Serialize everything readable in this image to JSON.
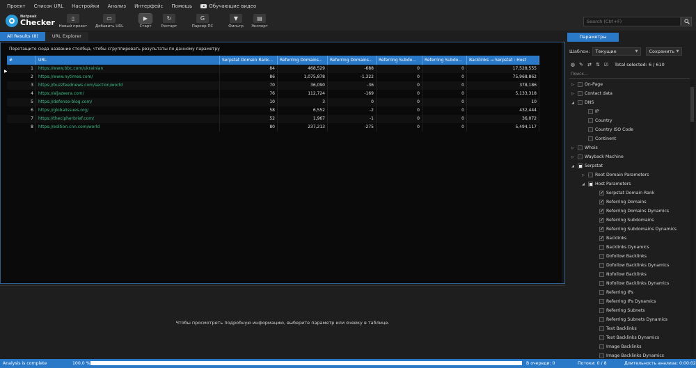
{
  "menu": [
    "Проект",
    "Список URL",
    "Настройки",
    "Анализ",
    "Интерфейс",
    "Помощь",
    "Обучающие видео"
  ],
  "logo": {
    "small": "Netpeak",
    "big": "Checker"
  },
  "toolbar": [
    {
      "label": "Новый проект",
      "icon": "new-file-icon",
      "glyph": "▯"
    },
    {
      "label": "Добавить URL",
      "icon": "folder-icon",
      "glyph": "▭"
    },
    {
      "label": "Старт",
      "icon": "play-icon",
      "glyph": "▶"
    },
    {
      "label": "Рестарт",
      "icon": "restart-icon",
      "glyph": "↻"
    },
    {
      "label": "Парсер ПС",
      "icon": "google-icon",
      "glyph": "G"
    },
    {
      "label": "Фильтр",
      "icon": "filter-icon",
      "glyph": "▼"
    },
    {
      "label": "Экспорт",
      "icon": "export-icon",
      "glyph": "▤"
    }
  ],
  "search": {
    "placeholder": "Search (Ctrl+F)"
  },
  "tabs": [
    "All Results (8)",
    "URL Explorer"
  ],
  "grid": {
    "group_hint": "Перетащите сюда название столбца, чтобы сгруппировать результаты по данному параметру",
    "columns": [
      "#",
      "URL",
      "Serpstat Domain Rank...",
      "Referring Domains...",
      "Referring Domains...",
      "Referring Subdo...",
      "Referring Subdo...",
      "Backlinks → Serpstat : Host"
    ],
    "rows": [
      [
        "1",
        "https://www.bbc.com/ukrainian",
        "84",
        "468,529",
        "-688",
        "0",
        "0",
        "17,528,555"
      ],
      [
        "2",
        "https://www.nytimes.com/",
        "86",
        "1,075,878",
        "-1,322",
        "0",
        "0",
        "75,968,862"
      ],
      [
        "3",
        "https://buzzfeednews.com/section/world",
        "70",
        "36,090",
        "-36",
        "0",
        "0",
        "378,186"
      ],
      [
        "4",
        "https://aljazeera.com/",
        "76",
        "112,724",
        "-169",
        "0",
        "0",
        "5,133,318"
      ],
      [
        "5",
        "https://defense-blog.com/",
        "10",
        "3",
        "0",
        "0",
        "0",
        "10"
      ],
      [
        "6",
        "https://globalissues.org/",
        "58",
        "6,552",
        "-2",
        "0",
        "0",
        "432,444"
      ],
      [
        "7",
        "https://thecipherbrief.com/",
        "52",
        "1,967",
        "-1",
        "0",
        "0",
        "36,072"
      ],
      [
        "8",
        "https://edition.cnn.com/world",
        "80",
        "237,213",
        "-275",
        "0",
        "0",
        "5,494,117"
      ]
    ]
  },
  "details": {
    "hint": "Чтобы просмотреть подробную информацию, выберите параметр или ячейку в таблице."
  },
  "panel": {
    "tab": "Параметры",
    "template_label": "Шаблон:",
    "template_value": "Текущие",
    "save_label": "Сохранить",
    "total_selected": "Total selected: 6 / 610",
    "filter_placeholder": "Поиск...",
    "tree": [
      {
        "label": "On-Page",
        "level": 0,
        "arrow": "▷",
        "check": "none"
      },
      {
        "label": "Contact data",
        "level": 0,
        "arrow": "▷",
        "check": "none"
      },
      {
        "label": "DNS",
        "level": 0,
        "arrow": "◢",
        "check": "none"
      },
      {
        "label": "IP",
        "level": 1,
        "arrow": "",
        "check": "none"
      },
      {
        "label": "Country",
        "level": 1,
        "arrow": "",
        "check": "none"
      },
      {
        "label": "Country ISO Code",
        "level": 1,
        "arrow": "",
        "check": "none"
      },
      {
        "label": "Continent",
        "level": 1,
        "arrow": "",
        "check": "none"
      },
      {
        "label": "Whois",
        "level": 0,
        "arrow": "▷",
        "check": "none"
      },
      {
        "label": "Wayback Machine",
        "level": 0,
        "arrow": "▷",
        "check": "none"
      },
      {
        "label": "Serpstat",
        "level": 0,
        "arrow": "◢",
        "check": "partial"
      },
      {
        "label": "Root Domain Parameters",
        "level": 1,
        "arrow": "▷",
        "check": "none"
      },
      {
        "label": "Host Parameters",
        "level": 1,
        "arrow": "◢",
        "check": "partial"
      },
      {
        "label": "Serpstat Domain Rank",
        "level": 2,
        "arrow": "",
        "check": "checked"
      },
      {
        "label": "Referring Domains",
        "level": 2,
        "arrow": "",
        "check": "checked"
      },
      {
        "label": "Referring Domains Dynamics",
        "level": 2,
        "arrow": "",
        "check": "checked"
      },
      {
        "label": "Referring Subdomains",
        "level": 2,
        "arrow": "",
        "check": "checked"
      },
      {
        "label": "Referring Subdomains Dynamics",
        "level": 2,
        "arrow": "",
        "check": "checked"
      },
      {
        "label": "Backlinks",
        "level": 2,
        "arrow": "",
        "check": "checked"
      },
      {
        "label": "Backlinks Dynamics",
        "level": 2,
        "arrow": "",
        "check": "none"
      },
      {
        "label": "Dofollow Backlinks",
        "level": 2,
        "arrow": "",
        "check": "none"
      },
      {
        "label": "Dofollow Backlinks Dynamics",
        "level": 2,
        "arrow": "",
        "check": "none"
      },
      {
        "label": "Nofollow Backlinks",
        "level": 2,
        "arrow": "",
        "check": "none"
      },
      {
        "label": "Nofollow Backlinks Dynamics",
        "level": 2,
        "arrow": "",
        "check": "none"
      },
      {
        "label": "Referring IPs",
        "level": 2,
        "arrow": "",
        "check": "none"
      },
      {
        "label": "Referring IPs Dynamics",
        "level": 2,
        "arrow": "",
        "check": "none"
      },
      {
        "label": "Referring Subnets",
        "level": 2,
        "arrow": "",
        "check": "none"
      },
      {
        "label": "Referring Subnets Dynamics",
        "level": 2,
        "arrow": "",
        "check": "none"
      },
      {
        "label": "Text Backlinks",
        "level": 2,
        "arrow": "",
        "check": "none"
      },
      {
        "label": "Text Backlinks Dynamics",
        "level": 2,
        "arrow": "",
        "check": "none"
      },
      {
        "label": "Image Backlinks",
        "level": 2,
        "arrow": "",
        "check": "none"
      },
      {
        "label": "Image Backlinks Dynamics",
        "level": 2,
        "arrow": "",
        "check": "none"
      }
    ]
  },
  "status": {
    "state": "Analysis is complete",
    "percent": "100,0 %",
    "progress": 1.0,
    "queue": "В очереди: 0",
    "threads": "Потоки: 0 / 8",
    "duration": "Длительность анализа: 0:00:02"
  },
  "colors": {
    "accent": "#2a79c9",
    "url": "#3dbb8a",
    "background": "#1e1e1e"
  }
}
